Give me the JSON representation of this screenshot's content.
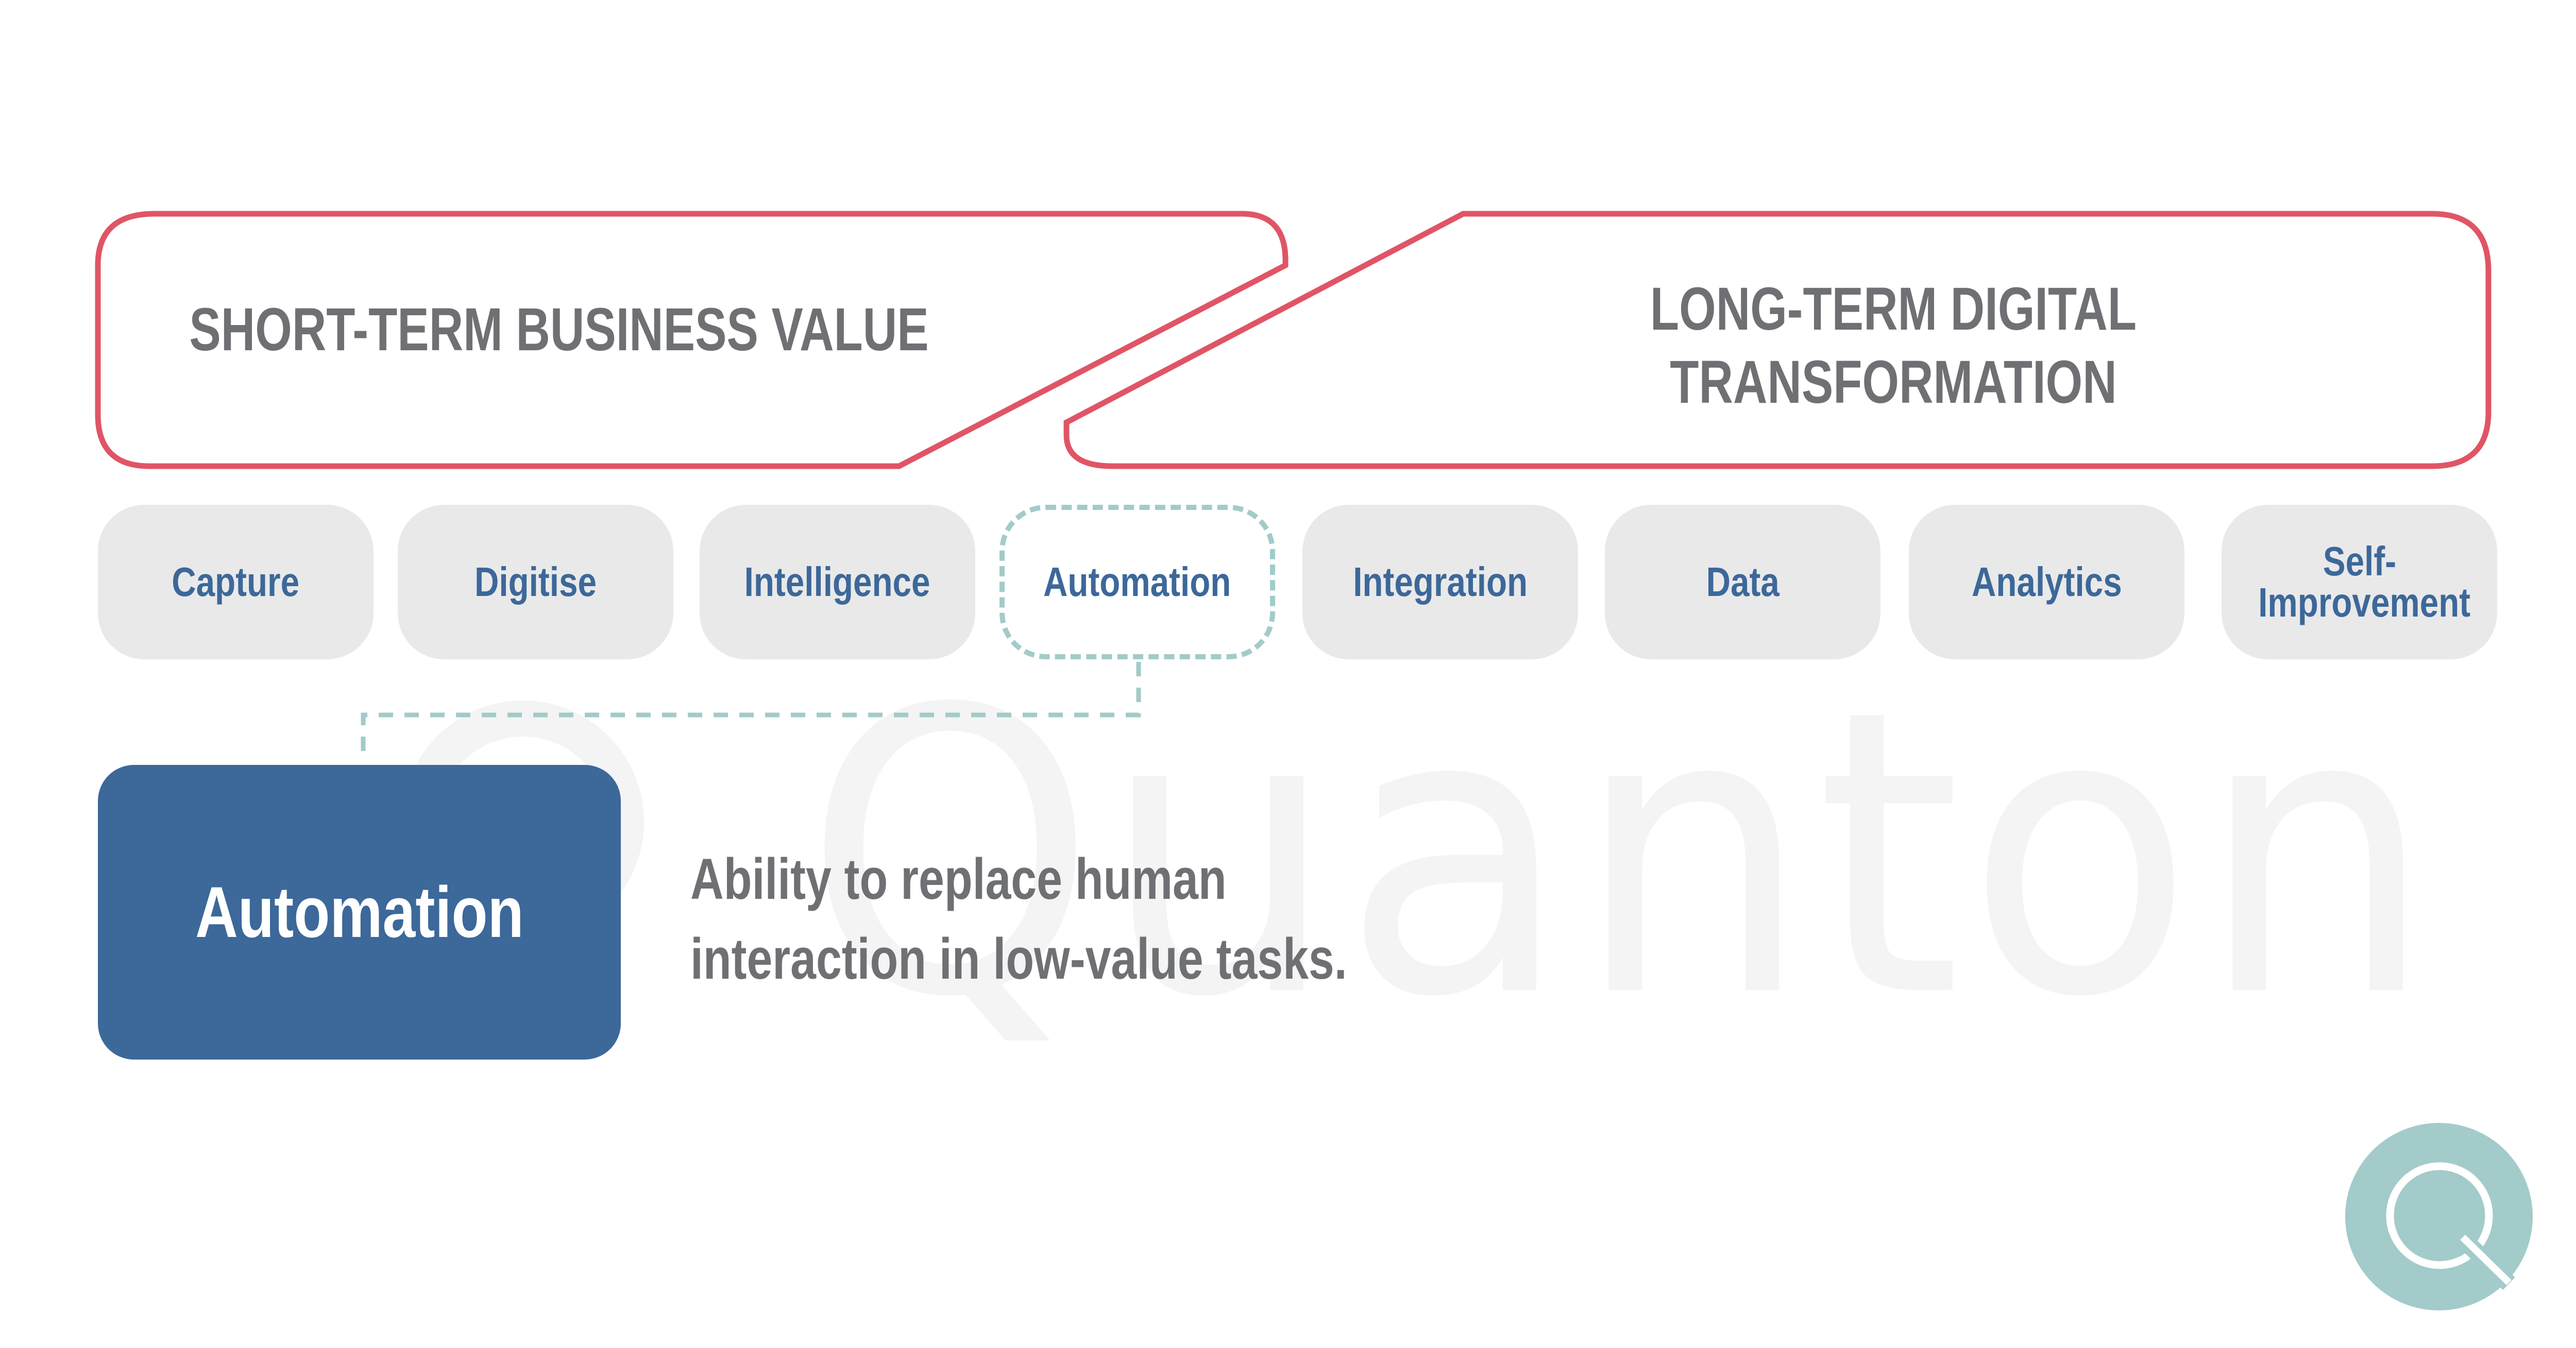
{
  "header": {
    "short_term_label": "SHORT-TERM BUSINESS VALUE",
    "long_term_label_line1": "LONG-TERM DIGITAL",
    "long_term_label_line2": "TRANSFORMATION"
  },
  "stages": [
    {
      "label": "Capture",
      "active": false
    },
    {
      "label": "Digitise",
      "active": false
    },
    {
      "label": "Intelligence",
      "active": false
    },
    {
      "label": "Automation",
      "active": true
    },
    {
      "label": "Integration",
      "active": false
    },
    {
      "label": "Data",
      "active": false
    },
    {
      "label": "Analytics",
      "active": false
    },
    {
      "label": "Self-Improvement",
      "active": false
    }
  ],
  "detail": {
    "title": "Automation",
    "description_line1": "Ability to replace human",
    "description_line2": "interaction in low-value tasks."
  },
  "watermark": {
    "text": "Quanton"
  },
  "logo": {
    "icon": "quanton-q-logo-icon"
  },
  "colors": {
    "frame_red": "#e05566",
    "stage_text_blue": "#3c689a",
    "stage_bg": "#e9e9e9",
    "dashed_teal": "#a2cbc9",
    "heading_gray": "#6f7074",
    "logo_teal": "#a2cbc9"
  }
}
